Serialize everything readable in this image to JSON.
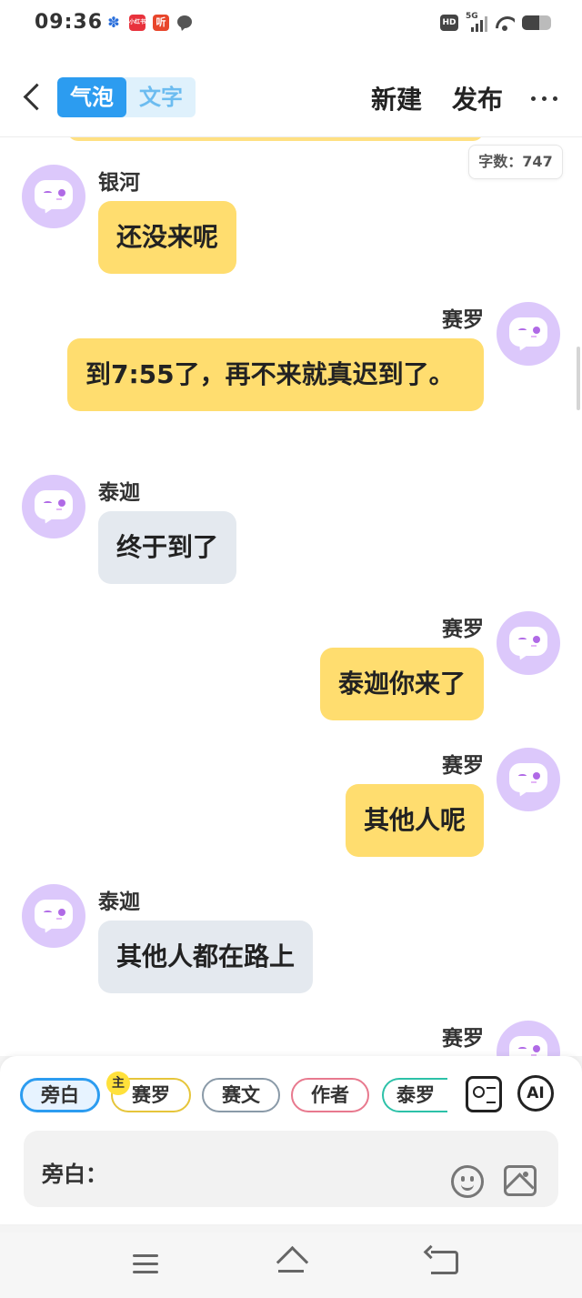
{
  "status_bar": {
    "time": "09:36",
    "badge_red1": "小红书",
    "badge_red2": "听",
    "hd": "HD",
    "network": "5G"
  },
  "topbar": {
    "mode_bubble": "气泡",
    "mode_text": "文字",
    "new_label": "新建",
    "publish_label": "发布"
  },
  "word_count": "字数：747",
  "messages": [
    {
      "speaker": "银河",
      "text": "还没来呢",
      "side": "left",
      "color": "yellow"
    },
    {
      "speaker": "赛罗",
      "text": "到7:55了，再不来就真迟到了。",
      "side": "right",
      "color": "yellow"
    },
    {
      "speaker": "泰迦",
      "text": "终于到了",
      "side": "left",
      "color": "grey"
    },
    {
      "speaker": "赛罗",
      "text": "泰迦你来了",
      "side": "right",
      "color": "yellow"
    },
    {
      "speaker": "赛罗",
      "text": "其他人呢",
      "side": "right",
      "color": "yellow"
    },
    {
      "speaker": "泰迦",
      "text": "其他人都在路上",
      "side": "left",
      "color": "grey"
    },
    {
      "speaker": "赛罗",
      "text": "",
      "side": "right",
      "color": "yellow"
    }
  ],
  "character_chips": [
    {
      "label": "旁白",
      "border": "#2c9cf0",
      "selected": true
    },
    {
      "label": "赛罗",
      "border": "#e6c53a",
      "host_badge": "主"
    },
    {
      "label": "赛文",
      "border": "#8a9aa8"
    },
    {
      "label": "作者",
      "border": "#e8798e"
    },
    {
      "label": "泰罗",
      "border": "#2cc1a8"
    }
  ],
  "ai_label": "AI",
  "input": {
    "label": "旁白："
  },
  "colors": {
    "accent": "#2c9cf0",
    "bubble_yellow": "#ffdd6f",
    "bubble_grey": "#e4e9ef",
    "avatar_purple": "#dcc8fb"
  },
  "icons": [
    "back-icon",
    "more-icon",
    "avatar-icon",
    "contact-card-icon",
    "emoji-icon",
    "image-icon",
    "nav-menu-icon",
    "nav-home-icon",
    "nav-back-icon"
  ]
}
